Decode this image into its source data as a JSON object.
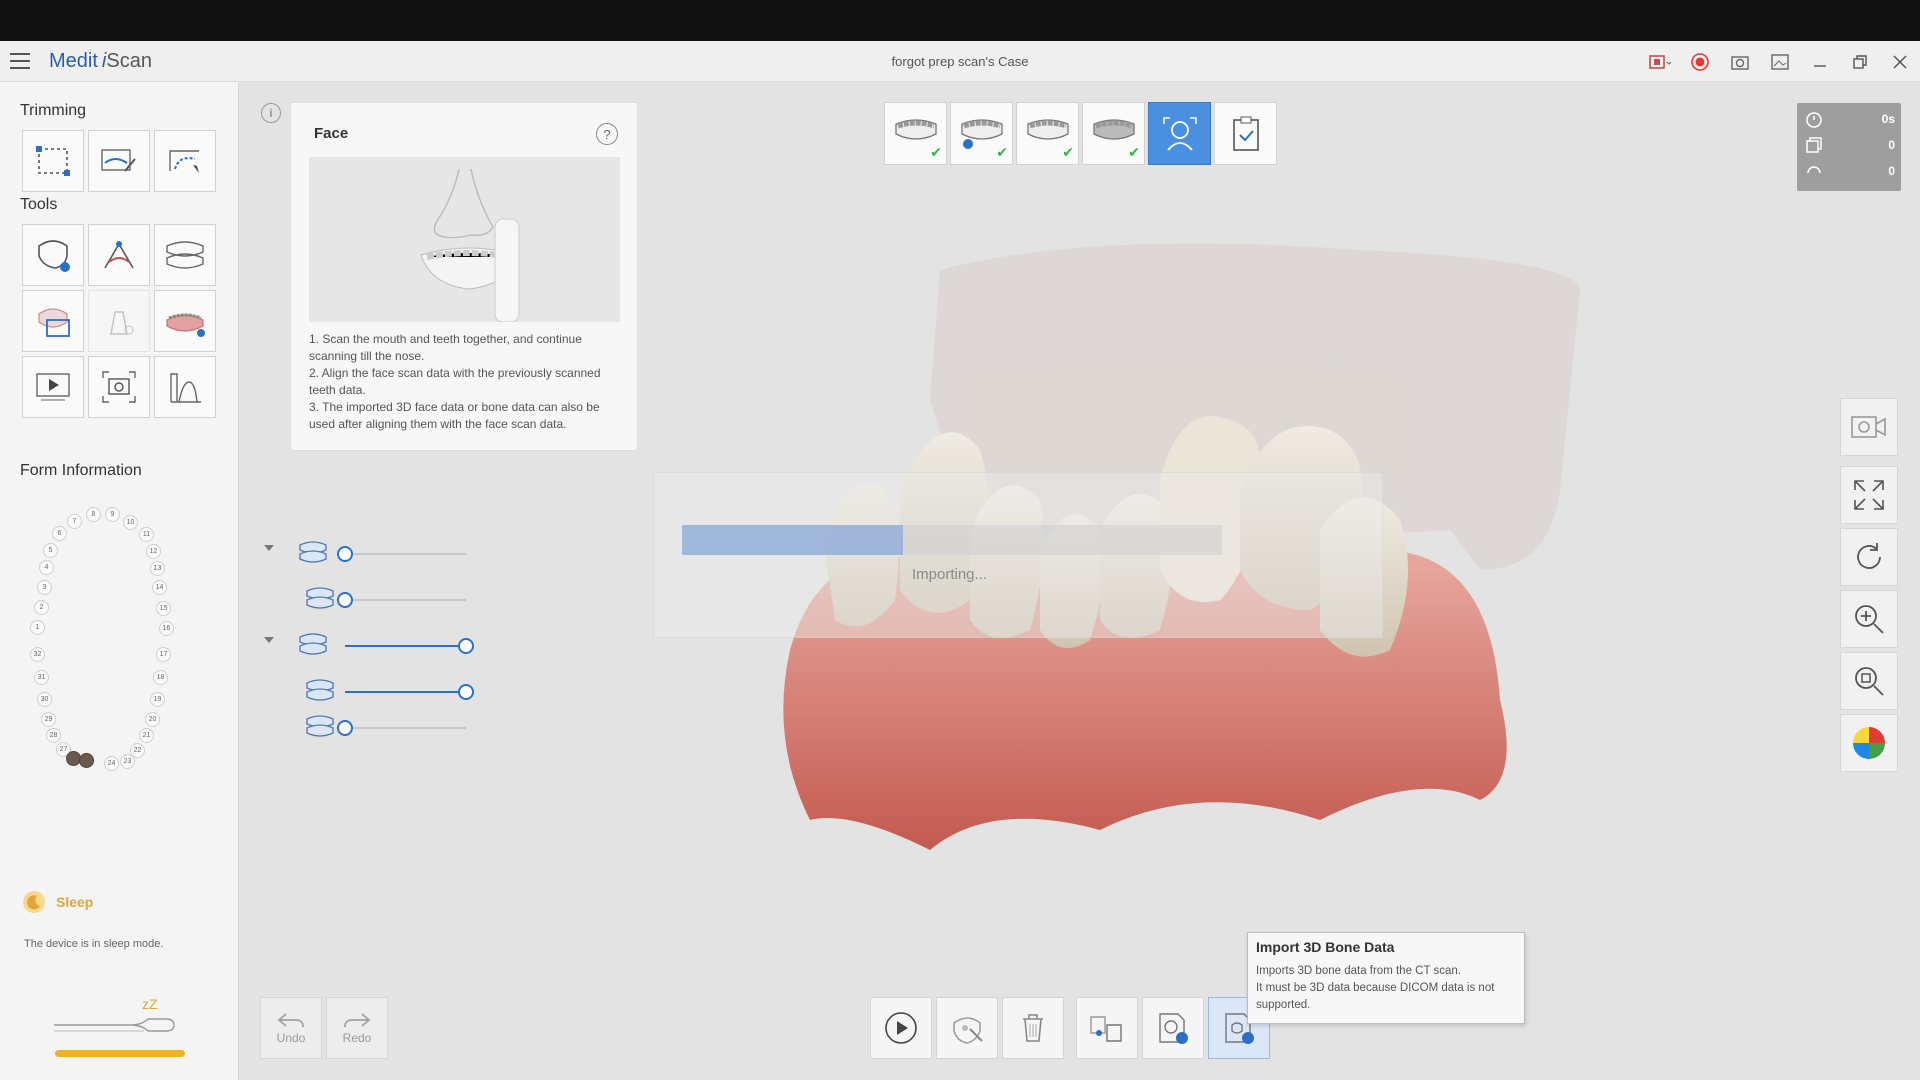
{
  "app": {
    "brand_main": "Medit",
    "brand_i": "i",
    "brand_scan": "Scan",
    "case_title": "forgot prep scan's Case"
  },
  "left_panel": {
    "trimming_title": "Trimming",
    "tools_title": "Tools",
    "form_title": "Form Information",
    "sleep_label": "Sleep",
    "sleep_desc": "The device is in sleep mode.",
    "sleep_z": "zZ"
  },
  "tooth_chart": {
    "upper": [
      "8",
      "9",
      "7",
      "10",
      "6",
      "11",
      "5",
      "12",
      "4",
      "13",
      "3",
      "14",
      "2",
      "15",
      "1",
      "16"
    ],
    "lower": [
      "32",
      "17",
      "31",
      "18",
      "30",
      "19",
      "29",
      "20",
      "28",
      "21",
      "27",
      "22",
      "26",
      "23",
      "25",
      "24"
    ]
  },
  "face_card": {
    "info_icon": "i",
    "title": "Face",
    "help": "?",
    "steps": [
      "1. Scan the mouth and teeth together, and continue scanning till the nose.",
      "2. Align the face scan data with the previously scanned teeth data.",
      "3. The imported 3D face data or bone data can also be used after aligning them with the face scan data."
    ]
  },
  "sliders": [
    {
      "group": true,
      "value": 0
    },
    {
      "group": false,
      "value": 0
    },
    {
      "group": true,
      "value": 1.0
    },
    {
      "group": false,
      "value": 1.0
    },
    {
      "group": false,
      "value": 0
    }
  ],
  "stages": [
    {
      "name": "maxilla",
      "done": true
    },
    {
      "name": "maxilla-prep",
      "done": true
    },
    {
      "name": "mandible",
      "done": true
    },
    {
      "name": "occlusion",
      "done": true
    },
    {
      "name": "face",
      "active": true
    },
    {
      "name": "review"
    }
  ],
  "stats": {
    "time": "0s",
    "count": "0",
    "rotation": "0"
  },
  "importing": {
    "label": "Importing...",
    "progress": 0.41
  },
  "bottom": {
    "undo": "Undo",
    "redo": "Redo"
  },
  "tooltip": {
    "title": "Import 3D Bone Data",
    "line1": "Imports 3D bone data from the CT scan.",
    "line2": "It must be 3D data because DICOM data is not supported."
  },
  "colors": {
    "accent": "#2a70c6",
    "active_stage": "#4a8fe0",
    "check": "#3bb04a",
    "sleep": "#f2b21f",
    "record": "#e53935"
  }
}
